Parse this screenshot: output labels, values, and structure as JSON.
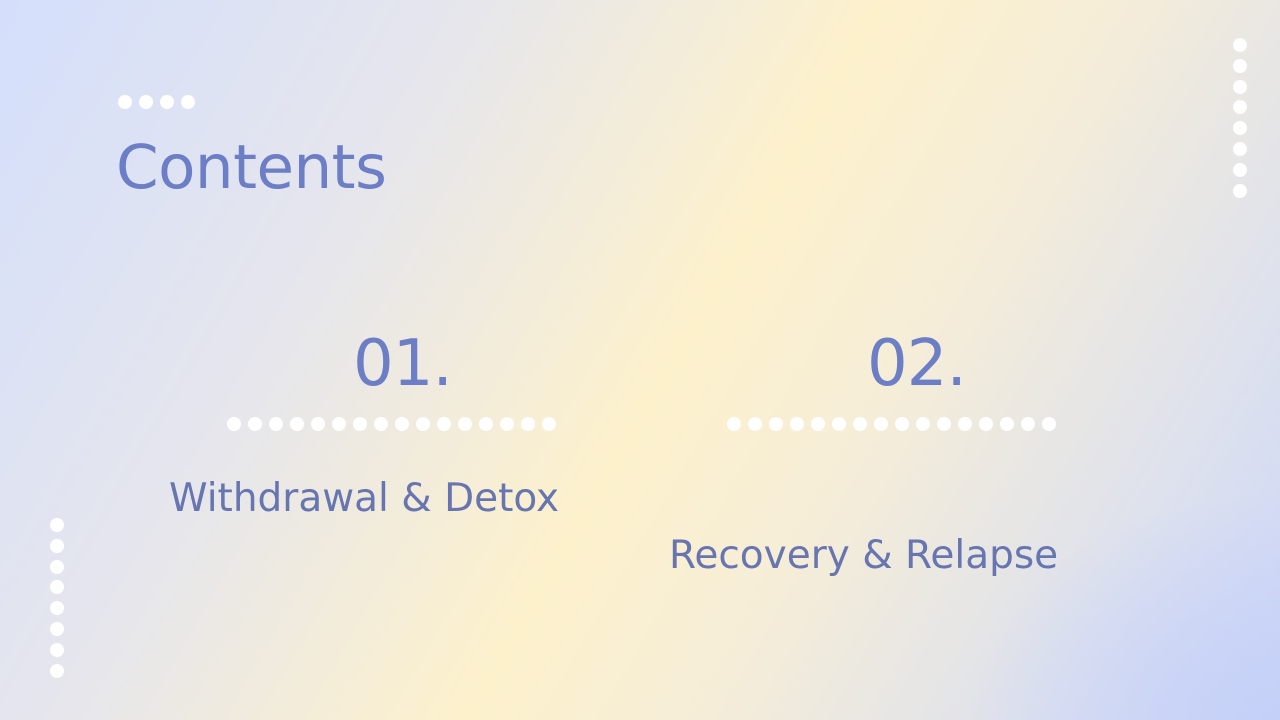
{
  "slide": {
    "title": "Contents",
    "items": [
      {
        "number": "01.",
        "label": "Withdrawal & Detox"
      },
      {
        "number": "02.",
        "label": "Recovery & Relapse"
      }
    ]
  },
  "colors": {
    "title": "#6b7ec6",
    "label": "#6775b0",
    "dots": "#ffffff",
    "bg_blue": "#d4dffc",
    "bg_yellow": "#fdf1cc"
  }
}
